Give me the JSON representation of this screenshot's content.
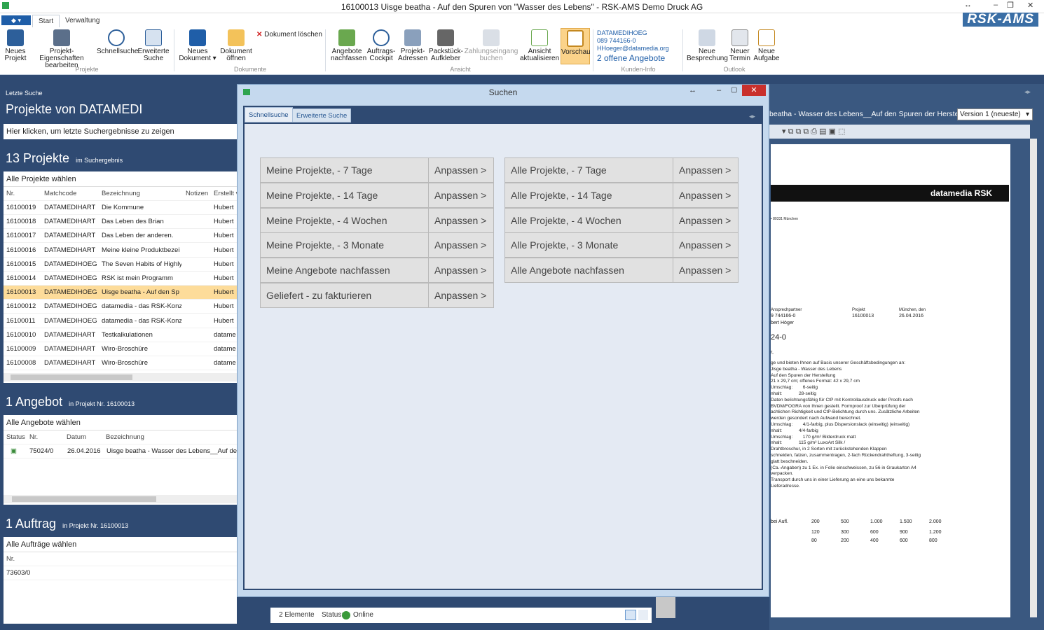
{
  "window": {
    "title": "16100013 Uisge beatha - Auf den Spuren von \"Wasser des Lebens\" - RSK-AMS  Demo Druck AG",
    "logo": "RSK-AMS"
  },
  "tabs": [
    "Start",
    "Verwaltung"
  ],
  "ribbon": {
    "projekte": {
      "label": "Projekte",
      "buttons": [
        "Neues Projekt",
        "Projekt-Eigenschaften bearbeiten",
        "Schnellsuche",
        "Erweiterte Suche"
      ]
    },
    "dokumente": {
      "label": "Dokumente",
      "buttons": [
        "Neues Dokument ▾",
        "Dokument öffnen"
      ],
      "delete": "Dokument löschen"
    },
    "ansicht": {
      "label": "Ansicht",
      "buttons": [
        "Angebote nachfassen",
        "Auftrags-Cockpit",
        "Projekt-Adressen",
        "Packstück-Aufkleber",
        "Zahlungseingang buchen",
        "Ansicht aktualisieren",
        "Vorschau"
      ]
    },
    "kunden": {
      "label": "Kunden-Info",
      "name": "DATAMEDIHOEG",
      "phone": "089 744166-0",
      "email": "HHoeger@datamedia.org",
      "offers": "2 offene Angebote"
    },
    "outlook": {
      "label": "Outlook",
      "buttons": [
        "Neue Besprechung",
        "Neuer Termin",
        "Neue Aufgabe"
      ]
    }
  },
  "left": {
    "last_search_label": "Letzte Suche",
    "projects_of": "Projekte von DATAMEDI",
    "last_search_hint": "Hier klicken, um letzte Suchergebnisse zu zeigen",
    "projects_count": "13 Projekte",
    "projects_count_sub": "im Suchergebnis",
    "all_projects": "Alle Projekte wählen",
    "project_columns": [
      "Nr.",
      "Matchcode",
      "Bezeichnung",
      "Notizen",
      "Erstellt v"
    ],
    "projects": [
      [
        "16100019",
        "DATAMEDIHART",
        "Die Kommune",
        "Hubert"
      ],
      [
        "16100018",
        "DATAMEDIHART",
        "Das Leben des Brian",
        "Hubert"
      ],
      [
        "16100017",
        "DATAMEDIHART",
        "Das Leben der anderen.",
        "Hubert"
      ],
      [
        "16100016",
        "DATAMEDIHART",
        "Meine kleine Produktbezei",
        "Hubert"
      ],
      [
        "16100015",
        "DATAMEDIHOEG",
        "The Seven Habits of Highly",
        "Hubert"
      ],
      [
        "16100014",
        "DATAMEDIHOEG",
        "RSK ist mein Programm",
        "Hubert"
      ],
      [
        "16100013",
        "DATAMEDIHOEG",
        "Uisge beatha - Auf den Sp",
        "Hubert"
      ],
      [
        "16100012",
        "DATAMEDIHOEG",
        "datamedia - das RSK-Konz",
        "Hubert"
      ],
      [
        "16100011",
        "DATAMEDIHOEG",
        "datamedia - das RSK-Konz",
        "Hubert"
      ],
      [
        "16100010",
        "DATAMEDIHART",
        "Testkalkulationen",
        "datame"
      ],
      [
        "16100009",
        "DATAMEDIHART",
        "Wiro-Broschüre",
        "datame"
      ],
      [
        "16100008",
        "DATAMEDIHART",
        "Wiro-Broschüre",
        "datame"
      ]
    ],
    "selected_project": "16100013",
    "offer_count": "1 Angebot",
    "offer_sub": "in Projekt Nr. 16100013",
    "all_offers": "Alle Angebote wählen",
    "offer_columns": [
      "Status",
      "Nr.",
      "Datum",
      "Bezeichnung"
    ],
    "offers": [
      [
        "75024/0",
        "26.04.2016",
        "Uisge beatha - Wasser des Lebens__Auf den S"
      ]
    ],
    "order_count": "1 Auftrag",
    "order_sub": "in Projekt Nr. 16100013",
    "all_orders": "Alle Aufträge wählen",
    "order_columns": [
      "Nr."
    ],
    "orders": [
      "73603/0"
    ]
  },
  "dialog": {
    "title": "Suchen",
    "tabs": [
      "Schnellsuche",
      "Erweiterte Suche"
    ],
    "left_buttons": [
      "Meine Projekte, - 7 Tage",
      "Meine Projekte, - 14 Tage",
      "Meine Projekte, - 4 Wochen",
      "Meine Projekte, - 3 Monate",
      "Meine Angebote nachfassen",
      "Geliefert - zu fakturieren"
    ],
    "right_buttons": [
      "Alle Projekte, - 7 Tage",
      "Alle Projekte, - 14 Tage",
      "Alle Projekte, - 4 Wochen",
      "Alle Projekte, - 3 Monate",
      "Alle Angebote nachfassen"
    ],
    "adjust_label": "Anpassen >"
  },
  "preview": {
    "doc_title": "beatha - Wasser des Lebens__Auf den Spuren der Herstell...",
    "version": "Version 1 (neueste)",
    "brand": "datamedia RSK",
    "address": "• 80331 München",
    "col_labels": [
      "Ansprechpartner",
      "Projekt",
      "München, den"
    ],
    "col_values": [
      "9 744166-0",
      "16100013",
      "26.04.2016"
    ],
    "person": "bert Höger",
    "ref": "24-0",
    "lines": [
      "ge und bieten Ihnen auf Basis unserer Geschäftsbedingungen an:",
      "Jisge beatha - Wasser des Lebens",
      "Auf den Spuren der Herstellung",
      "21 x 29,7 cm; offenes Format: 42 x 29,7 cm",
      "Umschlag:        6-seitig",
      "nhalt:             28-seitig",
      "Daten belichtungsfähig für CtP mit Kontrollausdruck oder Proofs nach",
      "BVDM/FOGRA von Ihnen gestellt. Formproof zur Überprüfung der",
      "achlichen Richtigkeit und CtP-Belichtung durch uns. Zusätzliche Arbeiten",
      "werden gesondert nach Aufwand berechnet.",
      "Umschlag:        4/1-farbig, plus Dispersionslack (einseitig) (einseitig)",
      "nhalt:             4/4-farbig",
      "Umschlag:        170 g/m² Bilderdruck matt",
      "nhalt:             115 g/m² LuxoArt Silk /",
      "Drahtbroschur, in 2 Sorten mit zurückstehenden Klappen",
      "schneiden, falzen, zusammentragen, 2-fach Rückendrahtheftung, 3-seitig",
      "glatt beschneiden.",
      "(Ca.-Angaben) zu 1 Ex. in Folie einschweissen, zu 56 in Graukarton A4",
      "verpacken.",
      "Transport durch uns in einer Lieferung an eine uns bekannte",
      "Lieferadresse."
    ],
    "qty_label": "bei Aufl.",
    "qty_cols": [
      "200",
      "500",
      "1.000",
      "1.500",
      "2.000"
    ],
    "qty_row1": [
      "120",
      "300",
      "600",
      "900",
      "1.200"
    ],
    "qty_row2": [
      "80",
      "200",
      "400",
      "600",
      "800"
    ]
  },
  "status": {
    "elements": "2 Elemente",
    "status_label": "Status:",
    "status_value": "Online"
  }
}
